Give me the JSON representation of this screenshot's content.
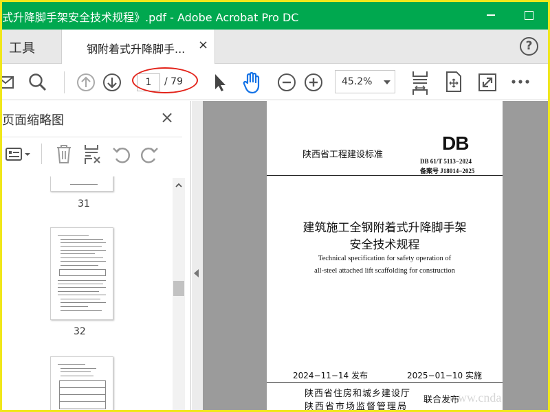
{
  "window": {
    "title": "式升降脚手架安全技术规程》.pdf - Adobe Acrobat Pro DC"
  },
  "tabs": {
    "tools_label": "工具",
    "document_label": "钢附着式升降脚手...",
    "close_glyph": "×",
    "help_glyph": "?"
  },
  "toolbar": {
    "page_current": "1",
    "page_total": "/ 79",
    "zoom_value": "45.2%",
    "icons": [
      "mail-icon",
      "search-icon",
      "page-up-icon",
      "page-down-icon",
      "select-cursor-icon",
      "hand-icon",
      "zoom-out-icon",
      "zoom-in-icon",
      "scroll-mode-icon",
      "fit-page-icon",
      "full-screen-icon",
      "more-icon"
    ],
    "accent": "#1473e6"
  },
  "left_panel": {
    "title": "页面缩略图",
    "close_glyph": "×",
    "thumbnails": [
      {
        "page_label": "31"
      },
      {
        "page_label": "32"
      }
    ]
  },
  "document_page": {
    "standard_type": "陕西省工程建设标准",
    "db_mark": "DB",
    "std_number": "DB  61/T  5113−2024",
    "record_number": "备案号   J18014−2025",
    "title_line1": "建筑施工全钢附着式升降脚手架",
    "title_line2": "安全技术规程",
    "english_line1": "Technical specification for safety operation of",
    "english_line2": "all-steel attached lift scaffolding for construction",
    "issue_date": "2024−11−14 发布",
    "effective_date": "2025−01−10 实施",
    "issuer1": "陕西省住房和城乡建设厅",
    "issuer2": "陕西省市场监督管理局",
    "joint_issue": "联合发布"
  },
  "watermark": "www.cnda",
  "colors": {
    "titlebar": "#00a84f",
    "frame_border": "#f0e71b",
    "annotation_ellipse": "#e3231a"
  }
}
